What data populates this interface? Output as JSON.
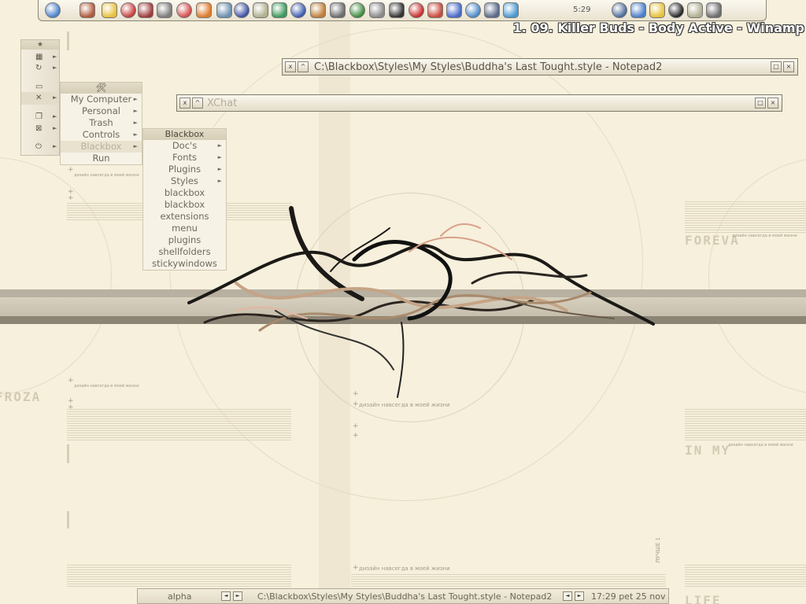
{
  "winamp": {
    "now_playing": "1. 09. Killer Buds - Body Active - Winamp"
  },
  "toolbar": {
    "clock": "5:29",
    "icons": [
      "ie-icon",
      "folder-icon",
      "flash-icon",
      "shutdown-icon",
      "record-icon",
      "media-icon",
      "diamond-icon",
      "firefox-icon",
      "mixer-icon",
      "notes-icon",
      "colors-icon",
      "refresh-icon",
      "display-icon",
      "image-icon",
      "tools-icon",
      "gear-icon",
      "gear-icon",
      "cd-icon",
      "opera-icon",
      "app-icon",
      "globe-icon",
      "globe-icon",
      "network-icon",
      "globe-icon",
      "monitor-icon",
      "globe-icon",
      "flash-icon",
      "terminal-icon",
      "colors-icon",
      "tools-icon"
    ],
    "colors": [
      "#4a7fc9",
      "#b35a3a",
      "#e8c23a",
      "#c93a3a",
      "#a03a3a",
      "#7c7c7c",
      "#d64a4a",
      "#e07a2a",
      "#6c8fb0",
      "#3a4fa0",
      "#b0b090",
      "#3a9a5a",
      "#3a5ab0",
      "#c0803a",
      "#6c6c6c",
      "#3a8a3a",
      "#8a8a8a",
      "#333333",
      "#c92a2a",
      "#c94a3a",
      "#4a6ac9",
      "#4a8ac9",
      "#5a6a8a",
      "#4a9ad0",
      "#4a6a9a",
      "#4a7fc9",
      "#e8c23a",
      "#222222",
      "#b0b090",
      "#6c6c6c"
    ]
  },
  "windows": {
    "notepad": {
      "title": "C:\\Blackbox\\Styles\\My Styles\\Buddha's Last Tought.style - Notepad2",
      "close": "x",
      "min": "^",
      "max": "□",
      "x_btn": "×"
    },
    "xchat": {
      "title": "XChat",
      "close": "x",
      "min": "^",
      "max": "□",
      "x_btn": "×"
    }
  },
  "left_strip": {
    "title": "★",
    "items": [
      "settings-icon",
      "refresh-icon",
      "folder-icon",
      "tools-icon",
      "window-icon",
      "close-icon",
      "power-icon"
    ]
  },
  "tools_menu": {
    "head_icon": "tools-icon",
    "items": [
      {
        "label": "My Computer",
        "arrow": true
      },
      {
        "label": "Personal",
        "arrow": true
      },
      {
        "label": "Trash",
        "arrow": true
      },
      {
        "label": "Controls",
        "arrow": true
      },
      {
        "label": "Blackbox",
        "arrow": true,
        "selected": true
      },
      {
        "label": "Run",
        "arrow": false
      }
    ]
  },
  "blackbox_menu": {
    "title": "Blackbox",
    "items": [
      {
        "label": "Doc's",
        "arrow": true
      },
      {
        "label": "Fonts",
        "arrow": true
      },
      {
        "label": "Plugins",
        "arrow": true
      },
      {
        "label": "Styles",
        "arrow": true
      },
      {
        "label": "blackbox",
        "arrow": false
      },
      {
        "label": "blackbox",
        "arrow": false
      },
      {
        "label": "extensions",
        "arrow": false
      },
      {
        "label": "menu",
        "arrow": false
      },
      {
        "label": "plugins",
        "arrow": false
      },
      {
        "label": "shellfolders",
        "arrow": false
      },
      {
        "label": "stickywindows",
        "arrow": false
      }
    ]
  },
  "wallpaper": {
    "tagline": "дизайн навсегда в моей жизни",
    "word_foreva": "FOREVA",
    "word_in_my": "IN MY",
    "word_life": "LIFE",
    "word_froza": "FROZA",
    "word_luchshe": "ЛУЧШЕ 1"
  },
  "taskbar": {
    "workspace": "alpha",
    "task": "C:\\Blackbox\\Styles\\My Styles\\Buddha's Last Tought.style - Notepad2",
    "clock": "17:29 pet 25 nov",
    "prev": "◄",
    "next": "►"
  }
}
